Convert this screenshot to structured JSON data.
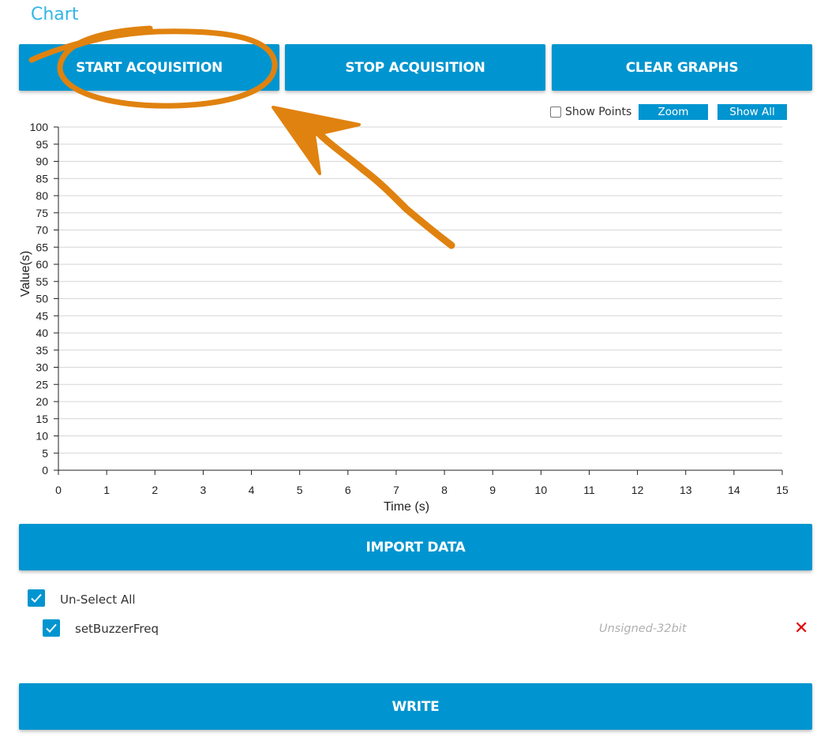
{
  "page": {
    "title": "Chart"
  },
  "toolbar": {
    "start_label": "START ACQUISITION",
    "stop_label": "STOP ACQUISITION",
    "clear_label": "CLEAR GRAPHS"
  },
  "chart_controls": {
    "show_points_label": "Show Points",
    "show_points_checked": false,
    "zoom_label": "Zoom",
    "show_all_label": "Show All"
  },
  "chart_data": {
    "type": "line",
    "xlabel": "Time (s)",
    "ylabel": "Value(s)",
    "xlim": [
      0,
      15
    ],
    "ylim": [
      0,
      100
    ],
    "x_ticks": [
      0,
      1,
      2,
      3,
      4,
      5,
      6,
      7,
      8,
      9,
      10,
      11,
      12,
      13,
      14,
      15
    ],
    "y_ticks": [
      0,
      5,
      10,
      15,
      20,
      25,
      30,
      35,
      40,
      45,
      50,
      55,
      60,
      65,
      70,
      75,
      80,
      85,
      90,
      95,
      100
    ],
    "grid": true,
    "series": []
  },
  "import": {
    "label": "IMPORT DATA"
  },
  "variables": {
    "unselect_all_label": "Un-Select All",
    "unselect_all_checked": true,
    "items": [
      {
        "name": "setBuzzerFreq",
        "type": "Unsigned-32bit",
        "checked": true,
        "delete_glyph": "✕"
      }
    ]
  },
  "write": {
    "label": "WRITE"
  },
  "colors": {
    "accent": "#0095d0",
    "title": "#33b5e5",
    "annotation": "#e0820f",
    "delete": "#e00000"
  },
  "annotation": {
    "type": "hand-drawn circle and arrow highlighting start-button"
  }
}
